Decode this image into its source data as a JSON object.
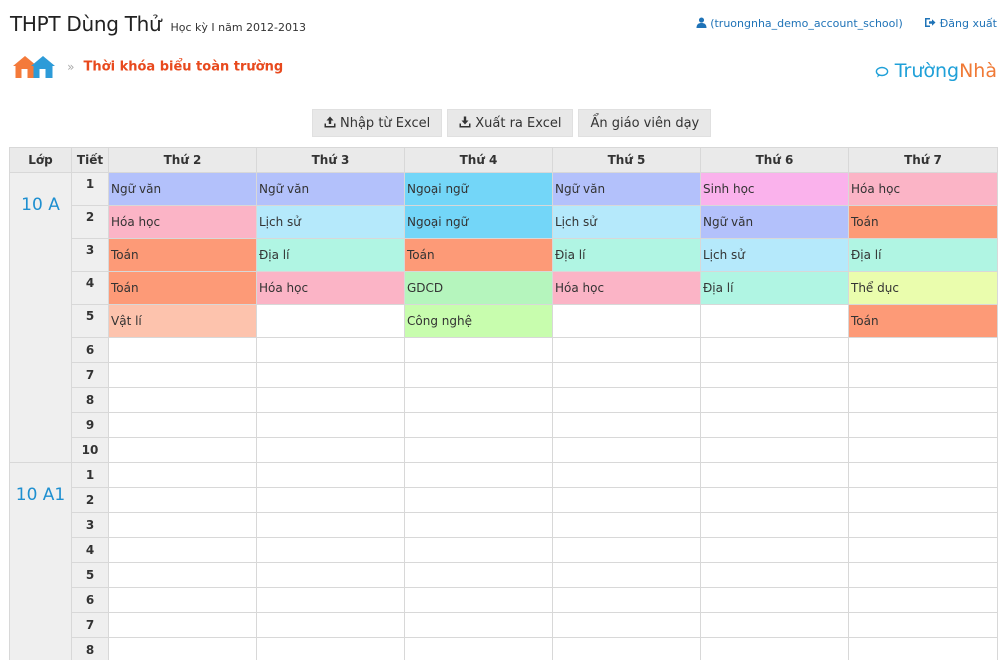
{
  "header": {
    "school_name": "THPT Dùng Thử",
    "semester": "Học kỳ I năm 2012-2013",
    "user_link": "(truongnha_demo_account_school)",
    "logout_link": "Đăng xuất"
  },
  "breadcrumb": {
    "separator": "»",
    "title": "Thời khóa biểu toàn trường"
  },
  "brand": {
    "part1": "Trường",
    "part2": "Nhà"
  },
  "toolbar": {
    "import_label": "Nhập từ Excel",
    "export_label": "Xuất ra Excel",
    "hide_teacher_label": "Ẩn giáo viên dạy"
  },
  "table": {
    "headers": [
      "Lớp",
      "Tiết",
      "Thứ 2",
      "Thứ 3",
      "Thứ 4",
      "Thứ 5",
      "Thứ 6",
      "Thứ 7"
    ],
    "classes": [
      {
        "name": "10 A",
        "periods": [
          {
            "num": "1",
            "cells": [
              {
                "text": "Ngữ văn",
                "color": "#b3c1fb"
              },
              {
                "text": "Ngữ văn",
                "color": "#b3c1fb"
              },
              {
                "text": "Ngoại ngữ",
                "color": "#73d6f8"
              },
              {
                "text": "Ngữ văn",
                "color": "#b3c1fb"
              },
              {
                "text": "Sinh học",
                "color": "#fab2ec"
              },
              {
                "text": "Hóa học",
                "color": "#fbb4c6"
              }
            ]
          },
          {
            "num": "2",
            "cells": [
              {
                "text": "Hóa học",
                "color": "#fbb4c6"
              },
              {
                "text": "Lịch sử",
                "color": "#b5e9fb"
              },
              {
                "text": "Ngoại ngữ",
                "color": "#73d6f8"
              },
              {
                "text": "Lịch sử",
                "color": "#b5e9fb"
              },
              {
                "text": "Ngữ văn",
                "color": "#b3c1fb"
              },
              {
                "text": "Toán",
                "color": "#fd9a77"
              }
            ]
          },
          {
            "num": "3",
            "cells": [
              {
                "text": "Toán",
                "color": "#fd9a77"
              },
              {
                "text": "Địa lí",
                "color": "#b0f5e3"
              },
              {
                "text": "Toán",
                "color": "#fd9a77"
              },
              {
                "text": "Địa lí",
                "color": "#b0f5e3"
              },
              {
                "text": "Lịch sử",
                "color": "#b5e9fb"
              },
              {
                "text": "Địa lí",
                "color": "#b0f5e3"
              }
            ]
          },
          {
            "num": "4",
            "cells": [
              {
                "text": "Toán",
                "color": "#fd9a77"
              },
              {
                "text": "Hóa học",
                "color": "#fbb4c6"
              },
              {
                "text": "GDCD",
                "color": "#b5f5bd"
              },
              {
                "text": "Hóa học",
                "color": "#fbb4c6"
              },
              {
                "text": "Địa lí",
                "color": "#b0f5e3"
              },
              {
                "text": "Thể dục",
                "color": "#eafdad"
              }
            ]
          },
          {
            "num": "5",
            "cells": [
              {
                "text": "Vật lí",
                "color": "#fdc3ad"
              },
              {
                "text": "",
                "color": ""
              },
              {
                "text": "Công nghệ",
                "color": "#c8fdae"
              },
              {
                "text": "",
                "color": ""
              },
              {
                "text": "",
                "color": ""
              },
              {
                "text": "Toán",
                "color": "#fd9a77"
              }
            ]
          },
          {
            "num": "6",
            "cells": []
          },
          {
            "num": "7",
            "cells": []
          },
          {
            "num": "8",
            "cells": []
          },
          {
            "num": "9",
            "cells": []
          },
          {
            "num": "10",
            "cells": []
          }
        ]
      },
      {
        "name": "10 A1",
        "periods": [
          {
            "num": "1",
            "cells": []
          },
          {
            "num": "2",
            "cells": []
          },
          {
            "num": "3",
            "cells": []
          },
          {
            "num": "4",
            "cells": []
          },
          {
            "num": "5",
            "cells": []
          },
          {
            "num": "6",
            "cells": []
          },
          {
            "num": "7",
            "cells": []
          },
          {
            "num": "8",
            "cells": []
          }
        ]
      }
    ]
  },
  "icons": [
    "user-icon",
    "logout-icon",
    "home-icon",
    "chat-icon",
    "upload-icon",
    "download-icon"
  ]
}
